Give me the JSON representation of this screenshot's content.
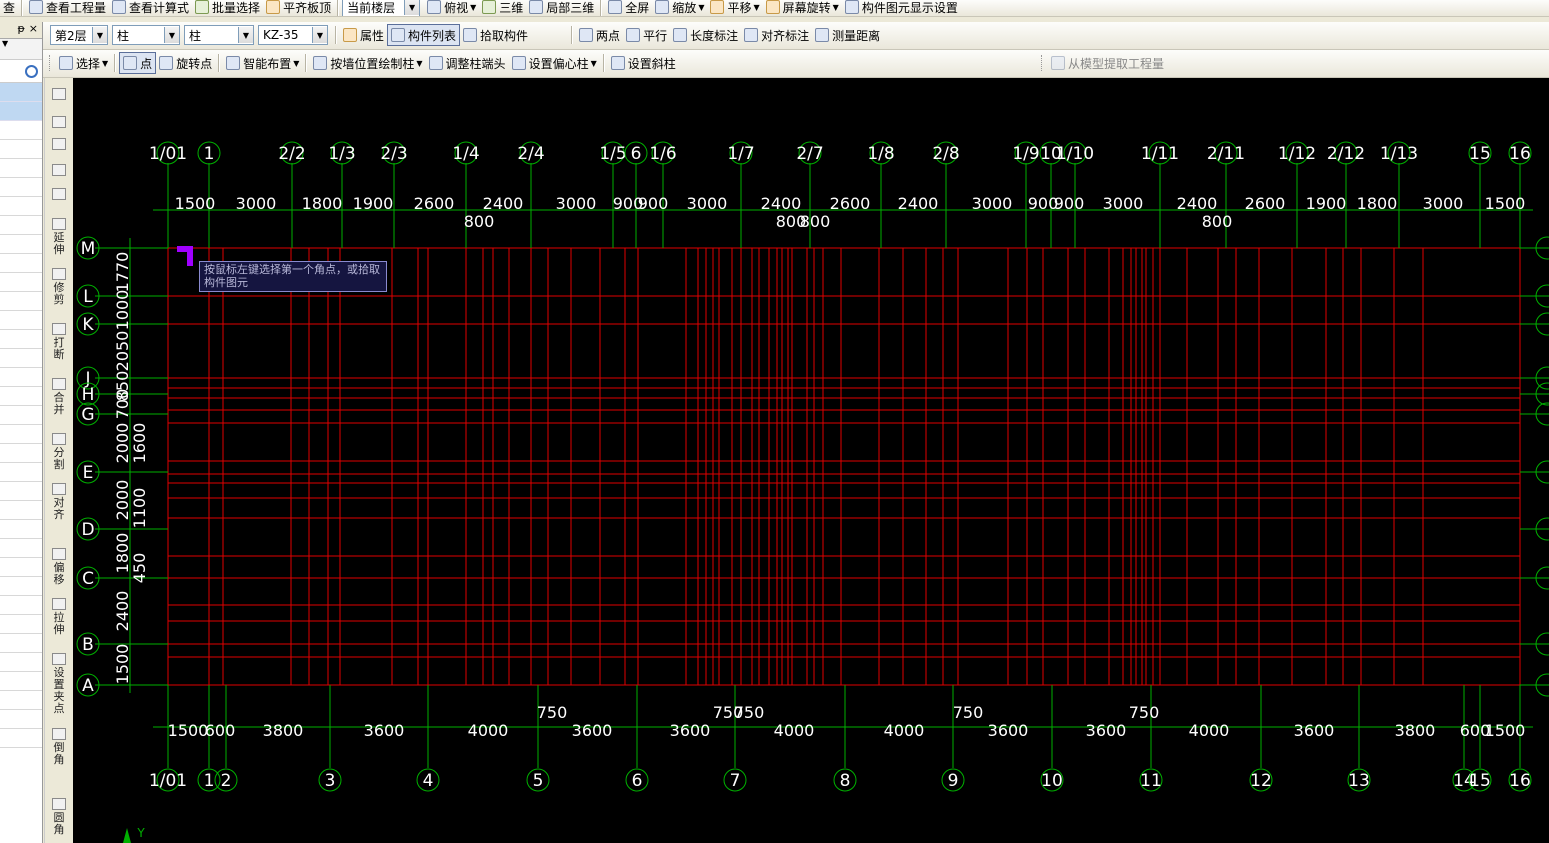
{
  "toolbar1": {
    "cut_label": "查",
    "view_quantity": "查看工程量",
    "view_formula": "查看计算式",
    "batch_select": "批量选择",
    "align_slab": "平齐板顶",
    "floor_scope": "当前楼层",
    "top_view": "俯视",
    "three_d": "三维",
    "local_3d": "局部三维",
    "fullscreen": "全屏",
    "zoom": "缩放",
    "pan": "平移",
    "rotate_screen": "屏幕旋转",
    "display_settings": "构件图元显示设置"
  },
  "toolbar2": {
    "floor": "第2层",
    "category": "柱",
    "type": "柱",
    "component": "KZ-35",
    "properties": "属性",
    "component_list": "构件列表",
    "pick_component": "拾取构件",
    "two_points": "两点",
    "parallel": "平行",
    "length_dim": "长度标注",
    "align_dim": "对齐标注",
    "measure": "测量距离"
  },
  "toolbar3": {
    "select": "选择",
    "point": "点",
    "rotate_point": "旋转点",
    "smart_layout": "智能布置",
    "draw_by_wall": "按墙位置绘制柱",
    "adjust_column_end": "调整柱端头",
    "set_eccentric": "设置偏心柱",
    "set_slant": "设置斜柱",
    "extract_quantity": "从模型提取工程量"
  },
  "side_panel": {
    "pin": "ᵽ",
    "close": "×"
  },
  "vertical_tools": [
    {
      "label": "",
      "icon": "brush-icon"
    },
    {
      "label": "",
      "icon": "copy-icon"
    },
    {
      "label": "",
      "icon": "mirror-icon"
    },
    {
      "label": "",
      "icon": "move-icon"
    },
    {
      "label": "",
      "icon": "rotate-icon"
    },
    {
      "label": "延伸",
      "icon": "extend-icon"
    },
    {
      "label": "修剪",
      "icon": "trim-icon"
    },
    {
      "label": "打断",
      "icon": "break-icon"
    },
    {
      "label": "合并",
      "icon": "merge-icon"
    },
    {
      "label": "分割",
      "icon": "split-icon"
    },
    {
      "label": "对齐",
      "icon": "align-icon"
    },
    {
      "label": "偏移",
      "icon": "offset-icon"
    },
    {
      "label": "拉伸",
      "icon": "stretch-icon"
    },
    {
      "label": "设置夹点",
      "icon": "grip-icon"
    },
    {
      "label": "倒角",
      "icon": "chamfer-icon"
    },
    {
      "label": "圆角",
      "icon": "fillet-icon"
    }
  ],
  "tooltip": "按鼠标左键选择第一个角点，或拾取构件图元",
  "colors": {
    "axis": "#00B000",
    "grid": "#E00000",
    "canvas_bg": "#000000",
    "dim_text": "#FFFFFF",
    "cursor": "#A000FF"
  },
  "drawing": {
    "top_axes": [
      "1/01",
      "1",
      "2/2",
      "1/3",
      "2/3",
      "1/4",
      "2/4",
      "1/5",
      "6",
      "1/6",
      "1/7",
      "2/7",
      "1/8",
      "2/8",
      "1/9",
      "10",
      "1/10",
      "1/11",
      "2/11",
      "1/12",
      "2/12",
      "1/13",
      "15",
      "16"
    ],
    "top_dims": [
      "1500",
      "3000",
      "1800",
      "1900",
      "2600",
      "2400",
      "3000",
      "900",
      "900",
      "3000",
      "2400",
      "2600",
      "2400",
      "3000",
      "900",
      "900",
      "3000",
      "2400",
      "2600",
      "1900",
      "1800",
      "3000",
      "1500"
    ],
    "top_dims_sub": [
      "800",
      "800",
      "800",
      "800"
    ],
    "bottom_axes": [
      "1/01",
      "1",
      "2",
      "3",
      "4",
      "5",
      "6",
      "7",
      "8",
      "9",
      "10",
      "11",
      "12",
      "13",
      "14",
      "15",
      "16"
    ],
    "bottom_dims": [
      "1500",
      "600",
      "3800",
      "3600",
      "4000",
      "3600",
      "3600",
      "4000",
      "4000",
      "3600",
      "3600",
      "4000",
      "3600",
      "3800",
      "600",
      "1500"
    ],
    "bottom_dims_sub": [
      "750",
      "750",
      "750",
      "750",
      "750"
    ],
    "left_axes": [
      "M",
      "L",
      "K",
      "J",
      "H",
      "G",
      "E",
      "D",
      "C",
      "B",
      "A"
    ],
    "left_dims": [
      "1770",
      "1000",
      "2050",
      "850",
      "700",
      "2000",
      "2000",
      "1800",
      "2400",
      "1500"
    ],
    "left_dims_sub": [
      "1600",
      "1100",
      "450"
    ],
    "ucs_label": "Y"
  }
}
